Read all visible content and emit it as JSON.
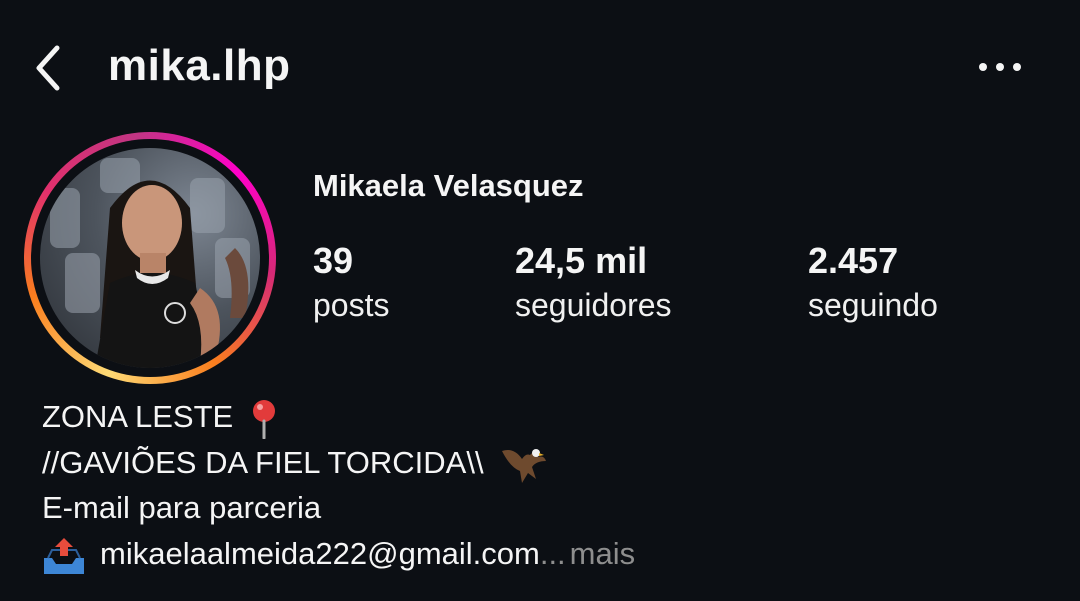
{
  "header": {
    "username": "mika.lhp",
    "back_icon": "chevron-left-icon",
    "more_icon": "more-horizontal-icon"
  },
  "profile": {
    "display_name": "Mikaela Velasquez",
    "story_ring_colors": [
      "#feda75",
      "#fa7e1e",
      "#e1306c",
      "#c13584",
      "#ff00c8"
    ]
  },
  "stats": [
    {
      "value": "39",
      "label": "posts"
    },
    {
      "value": "24,5 mil",
      "label": "seguidores"
    },
    {
      "value": "2.457",
      "label": "seguindo"
    }
  ],
  "bio": {
    "line1": "ZONA LESTE",
    "line1_icon": "round-pushpin-icon",
    "line2": "//GAVIÕES DA FIEL TORCIDA\\\\",
    "line2_icon": "eagle-icon",
    "line3": "E-mail para parceria",
    "line4_icon": "outbox-tray-icon",
    "line4": "mikaelaalmeida222@gmail.com",
    "ellipsis": "...",
    "more_label": "mais"
  },
  "colors": {
    "background": "#0c0f14",
    "text": "#f5f5f5",
    "muted": "#8e8e8e"
  }
}
